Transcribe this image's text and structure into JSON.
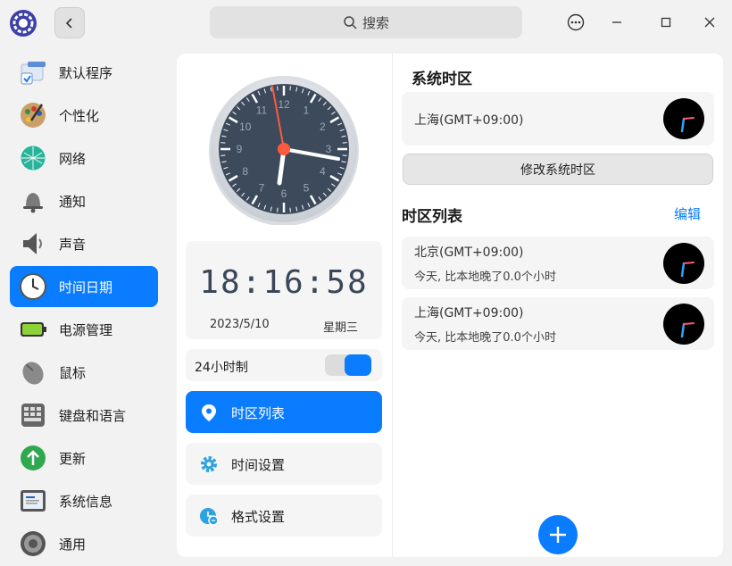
{
  "titlebar": {
    "search_placeholder": "搜索",
    "back_icon": "chevron-left-icon",
    "more_icon": "more-icon",
    "minimize_icon": "minimize-icon",
    "maximize_icon": "maximize-icon",
    "close_icon": "close-icon"
  },
  "sidebar": {
    "items": [
      {
        "label": "默认程序",
        "icon": "default-apps-icon"
      },
      {
        "label": "个性化",
        "icon": "personalization-icon"
      },
      {
        "label": "网络",
        "icon": "network-icon"
      },
      {
        "label": "通知",
        "icon": "bell-icon"
      },
      {
        "label": "声音",
        "icon": "speaker-icon"
      },
      {
        "label": "时间日期",
        "icon": "clock-icon",
        "active": true
      },
      {
        "label": "电源管理",
        "icon": "battery-icon"
      },
      {
        "label": "鼠标",
        "icon": "mouse-icon"
      },
      {
        "label": "键盘和语言",
        "icon": "keyboard-icon"
      },
      {
        "label": "更新",
        "icon": "update-icon"
      },
      {
        "label": "系统信息",
        "icon": "system-info-icon"
      },
      {
        "label": "通用",
        "icon": "general-icon"
      }
    ]
  },
  "clock": {
    "digital_time": "18:16:58",
    "date": "2023/5/10",
    "weekday": "星期三",
    "dial_numbers": [
      "12",
      "1",
      "2",
      "3",
      "4",
      "5",
      "6",
      "7",
      "8",
      "9",
      "10",
      "11"
    ]
  },
  "settings": {
    "hour24_label": "24小时制",
    "hour24_enabled": true,
    "menu": [
      {
        "label": "时区列表",
        "icon": "location-pin-icon",
        "active": true
      },
      {
        "label": "时间设置",
        "icon": "gear-icon",
        "active": false
      },
      {
        "label": "格式设置",
        "icon": "format-clock-icon",
        "active": false
      }
    ]
  },
  "system_timezone": {
    "title": "系统时区",
    "city": "上海(GMT+09:00)",
    "change_button": "修改系统时区"
  },
  "timezone_list": {
    "title": "时区列表",
    "edit_label": "编辑",
    "items": [
      {
        "city": "北京(GMT+09:00)",
        "diff": "今天, 比本地晚了0.0个小时"
      },
      {
        "city": "上海(GMT+09:00)",
        "diff": "今天, 比本地晚了0.0个小时"
      }
    ]
  },
  "colors": {
    "accent": "#0a7cff",
    "clock_face": "#3d4a5c",
    "second_hand": "#ff5a3c"
  }
}
